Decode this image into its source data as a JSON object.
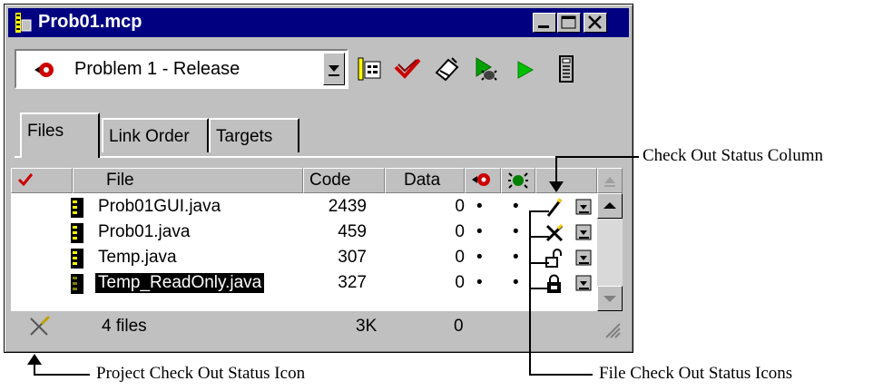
{
  "window": {
    "title": "Prob01.mcp"
  },
  "toolbar": {
    "target_select": "Problem 1 - Release",
    "tools": [
      "target-settings-icon",
      "checkmark-icon",
      "make-icon",
      "debug-icon",
      "run-icon",
      "project-inspector-icon"
    ]
  },
  "tabs": [
    "Files",
    "Link Order",
    "Targets"
  ],
  "columns": {
    "file": "File",
    "code": "Code",
    "data": "Data"
  },
  "files": [
    {
      "name": "Prob01GUI.java",
      "code": "2439",
      "data": "0",
      "dot1": "•",
      "dot2": "•",
      "status": "checked-out-icon"
    },
    {
      "name": "Prob01.java",
      "code": "459",
      "data": "0",
      "dot1": "•",
      "dot2": "•",
      "status": "not-in-vcs-icon"
    },
    {
      "name": "Temp.java",
      "code": "307",
      "data": "0",
      "dot1": "•",
      "dot2": "•",
      "status": "unlocked-icon"
    },
    {
      "name": "Temp_ReadOnly.java",
      "code": "327",
      "data": "0",
      "dot1": "•",
      "dot2": "•",
      "status": "locked-icon"
    }
  ],
  "footer": {
    "count": "4 files",
    "code_total": "3K",
    "data_total": "0"
  },
  "callouts": {
    "column": "Check Out Status Column",
    "project_icon": "Project Check Out Status Icon",
    "file_icons": "File Check Out Status Icons"
  }
}
